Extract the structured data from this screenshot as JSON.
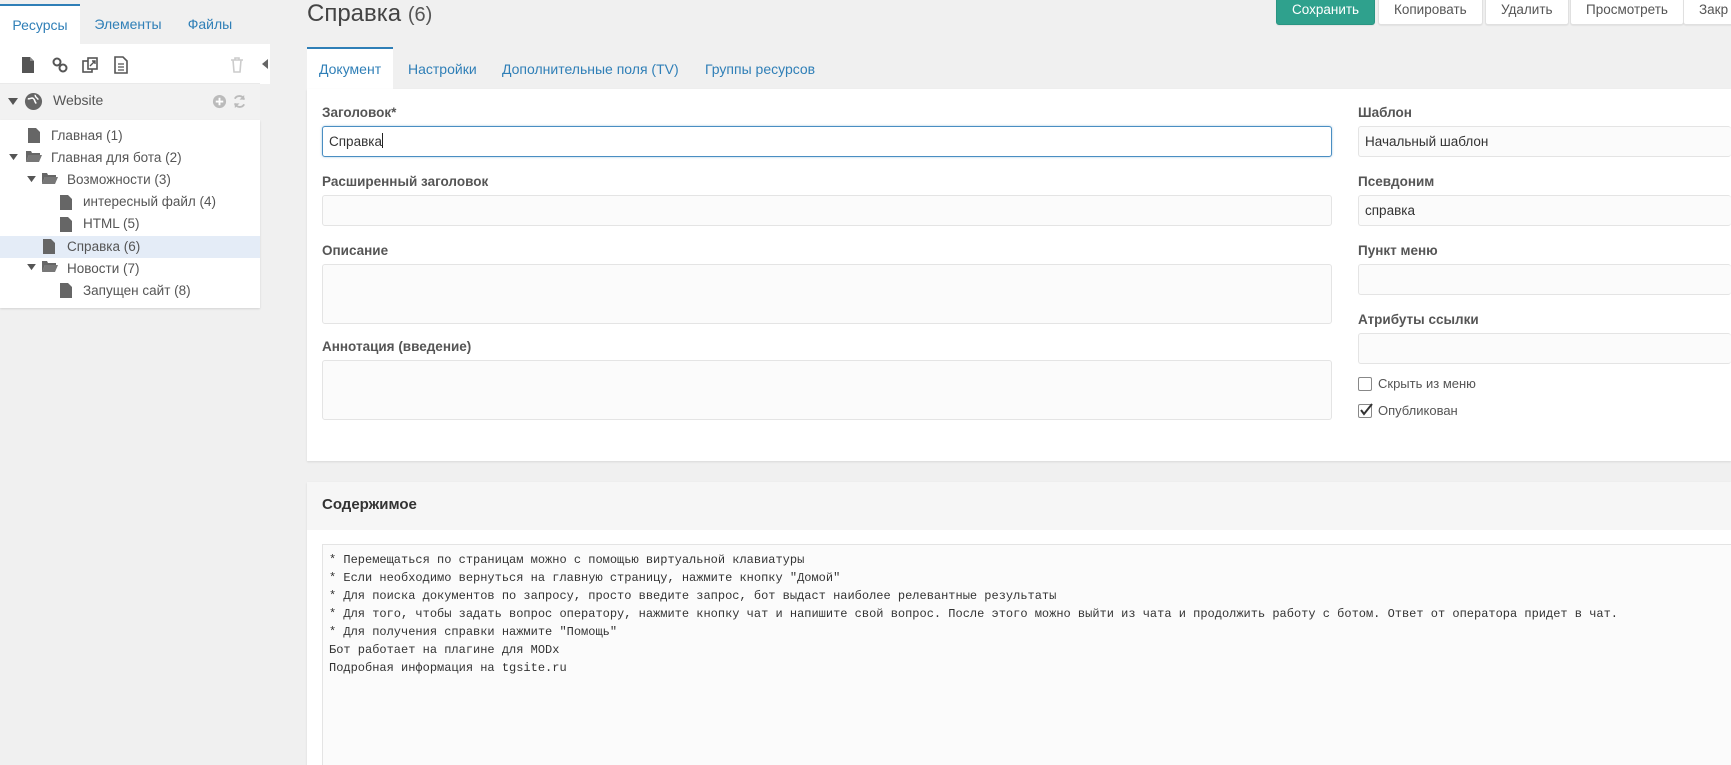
{
  "left_tabs": [
    {
      "label": "Ресурсы",
      "active": true
    },
    {
      "label": "Элементы",
      "active": false
    },
    {
      "label": "Файлы",
      "active": false
    }
  ],
  "toolbar_icons": [
    "new-document-icon",
    "weblink-icon",
    "symlink-icon",
    "static-resource-icon",
    "trash-icon"
  ],
  "tree": {
    "root": "Website",
    "nodes": [
      {
        "label": "Главная (1)",
        "type": "doc",
        "level": 0
      },
      {
        "label": "Главная для бота (2)",
        "type": "folder",
        "level": 0
      },
      {
        "label": "Возможности (3)",
        "type": "folder",
        "level": 1
      },
      {
        "label": "интересный файл (4)",
        "type": "doc",
        "level": 2
      },
      {
        "label": "HTML (5)",
        "type": "doc",
        "level": 2
      },
      {
        "label": "Справка (6)",
        "type": "doc",
        "level": 1,
        "selected": true
      },
      {
        "label": "Новости (7)",
        "type": "folder",
        "level": 1
      },
      {
        "label": "Запущен сайт (8)",
        "type": "doc",
        "level": 2
      }
    ]
  },
  "header": {
    "title": "Справка",
    "count": "(6)",
    "buttons": {
      "save": "Сохранить",
      "copy": "Копировать",
      "delete": "Удалить",
      "view": "Просмотреть",
      "close": "Закр"
    }
  },
  "main_tabs": [
    {
      "label": "Документ",
      "active": true
    },
    {
      "label": "Настройки",
      "active": false
    },
    {
      "label": "Дополнительные поля (TV)",
      "active": false
    },
    {
      "label": "Группы ресурсов",
      "active": false
    }
  ],
  "form": {
    "title_label": "Заголовок*",
    "title_value": "Справка",
    "longtitle_label": "Расширенный заголовок",
    "longtitle_value": "",
    "description_label": "Описание",
    "description_value": "",
    "introtext_label": "Аннотация (введение)",
    "introtext_value": "",
    "template_label": "Шаблон",
    "template_value": "Начальный шаблон",
    "alias_label": "Псевдоним",
    "alias_value": "справка",
    "menutitle_label": "Пункт меню",
    "menutitle_value": "",
    "link_attributes_label": "Атрибуты ссылки",
    "link_attributes_value": "",
    "hide_menu_label": "Скрыть из меню",
    "hide_menu_checked": false,
    "published_label": "Опубликован",
    "published_checked": true
  },
  "content": {
    "title": "Содержимое",
    "lines": [
      "* Перемещаться по страницам можно с помощью виртуальной клавиатуры",
      "* Если необходимо вернуться на главную страницу, нажмите кнопку \"Домой\"",
      "* Для поиска документов по запросу, просто введите запрос, бот выдаст наиболее релевантные результаты",
      "* Для того, чтобы задать вопрос оператору, нажмите кнопку чат и напишите свой вопрос. После этого можно выйти из чата и продолжить работу с ботом. Ответ от оператора придет в чат.",
      "* Для получения справки нажмите \"Помощь\"",
      "Бот работает на плагине для MODx",
      "Подробная информация на tgsite.ru"
    ]
  },
  "colors": {
    "accent": "#2f7fb7",
    "primary_button": "#2fa18d",
    "selected_row": "#e4ecf7",
    "background": "#f0f0f0"
  }
}
